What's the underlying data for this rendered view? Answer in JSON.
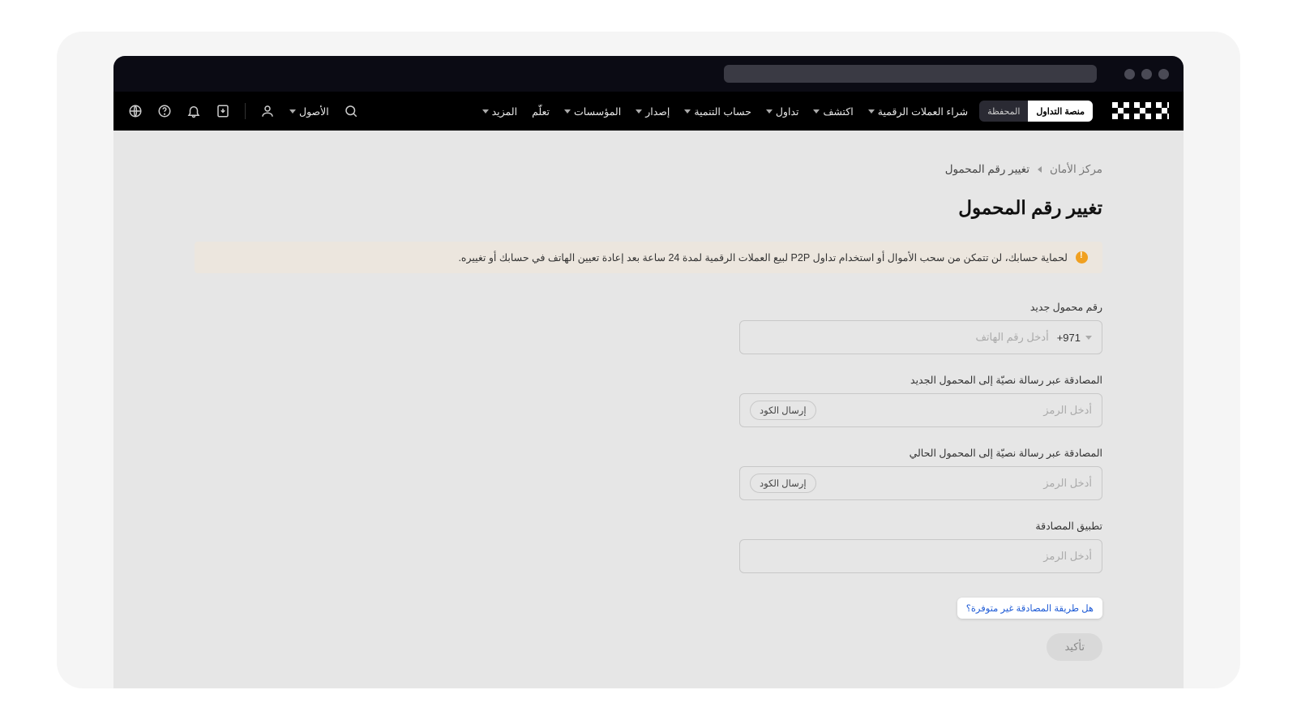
{
  "toggle": {
    "active": "منصة التداول",
    "inactive": "المحفظة"
  },
  "nav": {
    "items": [
      "شراء العملات الرقمية",
      "اكتشف",
      "تداول",
      "حساب التنمية",
      "إصدار",
      "المؤسسات",
      "تعلّم",
      "المزيد"
    ],
    "assets": "الأصول"
  },
  "breadcrumb": {
    "root": "مركز الأمان",
    "current": "تغيير رقم المحمول"
  },
  "title": "تغيير رقم المحمول",
  "warning": "لحماية حسابك، لن تتمكن من سحب الأموال أو استخدام تداول P2P لبيع العملات الرقمية لمدة 24 ساعة بعد إعادة تعيين الهاتف في حسابك أو تغييره.",
  "fields": {
    "new_mobile": {
      "label": "رقم محمول جديد",
      "cc": "+971",
      "placeholder": "أدخل رقم الهاتف"
    },
    "sms_new": {
      "label": "المصادقة عبر رسالة نصيّة إلى المحمول الجديد",
      "placeholder": "أدخل الرمز",
      "button": "إرسال الكود"
    },
    "sms_current": {
      "label": "المصادقة عبر رسالة نصيّة إلى المحمول الحالي",
      "placeholder": "أدخل الرمز",
      "button": "إرسال الكود"
    },
    "auth_app": {
      "label": "تطبيق المصادقة",
      "placeholder": "أدخل الرمز"
    }
  },
  "help": "هل طريقة المصادقة غير متوفرة؟",
  "confirm": "تأكيد"
}
